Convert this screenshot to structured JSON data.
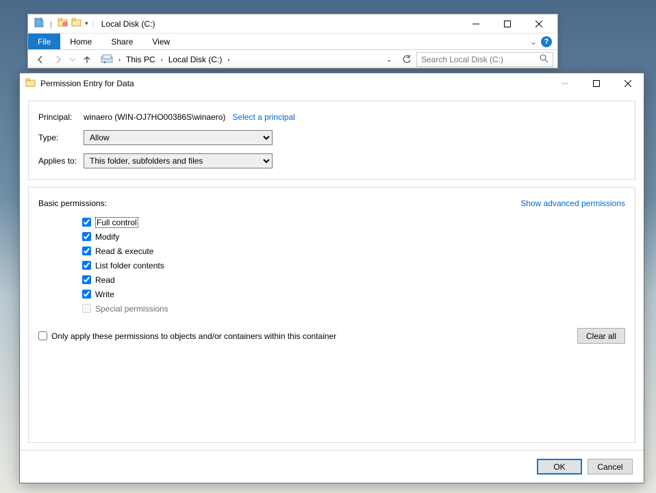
{
  "explorer": {
    "title": "Local Disk (C:)",
    "tabs": {
      "file": "File",
      "home": "Home",
      "share": "Share",
      "view": "View"
    },
    "breadcrumb": {
      "thispc": "This PC",
      "drive": "Local Disk (C:)"
    },
    "search_placeholder": "Search Local Disk (C:)"
  },
  "dialog": {
    "title": "Permission Entry for Data",
    "principal_label": "Principal:",
    "principal_value": "winaero (WIN-OJ7HO00386S\\winaero)",
    "select_principal": "Select a principal",
    "type_label": "Type:",
    "type_value": "Allow",
    "applies_label": "Applies to:",
    "applies_value": "This folder, subfolders and files",
    "basic_permissions_label": "Basic permissions:",
    "show_advanced": "Show advanced permissions",
    "permissions": [
      {
        "label": "Full control",
        "checked": true,
        "enabled": true,
        "focused": true
      },
      {
        "label": "Modify",
        "checked": true,
        "enabled": true,
        "focused": false
      },
      {
        "label": "Read & execute",
        "checked": true,
        "enabled": true,
        "focused": false
      },
      {
        "label": "List folder contents",
        "checked": true,
        "enabled": true,
        "focused": false
      },
      {
        "label": "Read",
        "checked": true,
        "enabled": true,
        "focused": false
      },
      {
        "label": "Write",
        "checked": true,
        "enabled": true,
        "focused": false
      },
      {
        "label": "Special permissions",
        "checked": false,
        "enabled": false,
        "focused": false
      }
    ],
    "only_apply": "Only apply these permissions to objects and/or containers within this container",
    "clear_all": "Clear all",
    "ok": "OK",
    "cancel": "Cancel"
  }
}
